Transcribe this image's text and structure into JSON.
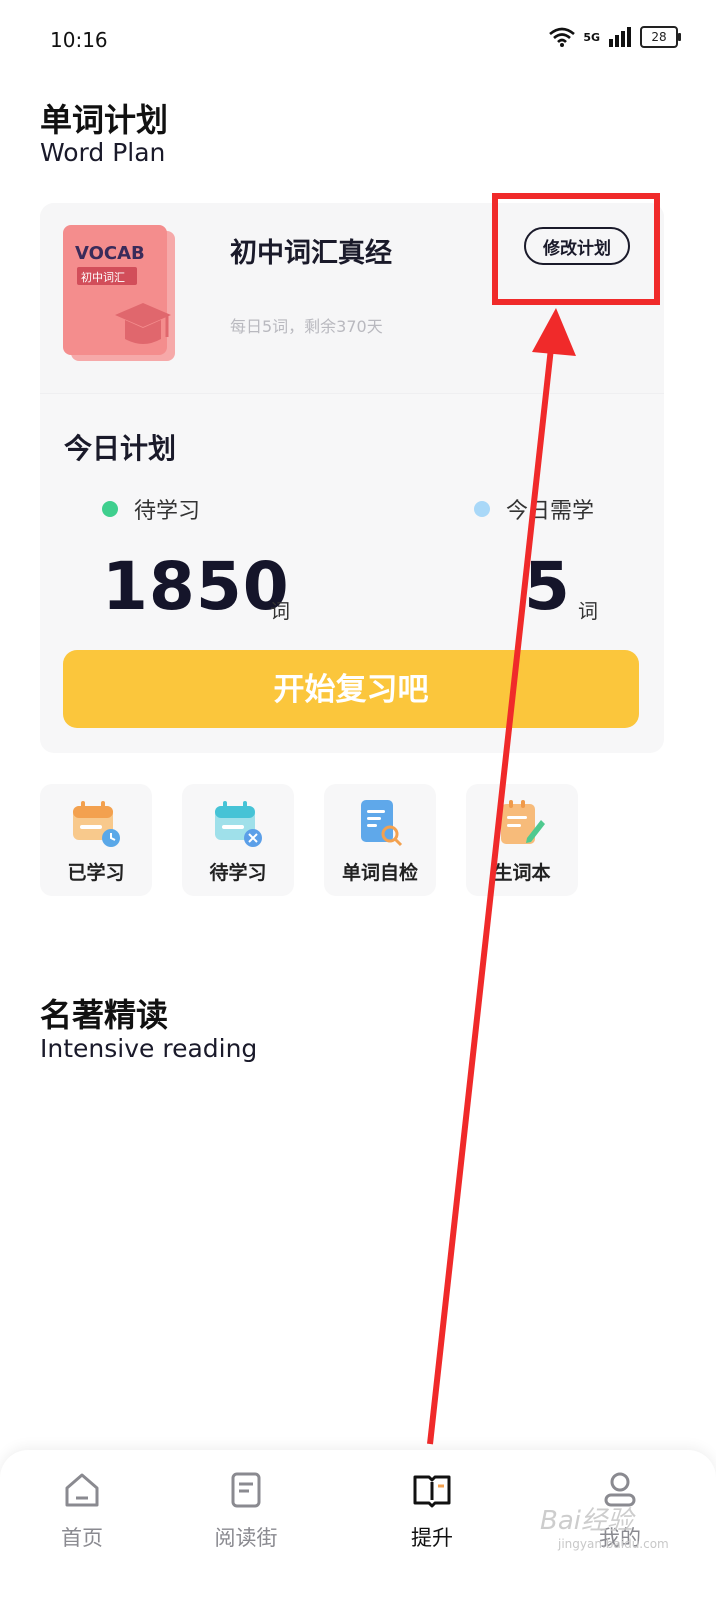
{
  "status_bar": {
    "time": "10:16",
    "network": "5G",
    "battery": "28"
  },
  "word_plan": {
    "title": "单词计划",
    "subtitle": "Word Plan"
  },
  "book": {
    "cover_title": "VOCAB",
    "cover_tag": "初中词汇",
    "title": "初中词汇真经",
    "progress": "每日5词，剩余370天",
    "modify_label": "修改计划"
  },
  "today": {
    "title": "今日计划",
    "pending_label": "待学习",
    "pending_count": "1850",
    "need_label": "今日需学",
    "need_count": "5",
    "unit": "词",
    "pending_color": "#3fcf8e",
    "need_color": "#a9d8f8",
    "start_label": "开始复习吧"
  },
  "tools": [
    {
      "label": "已学习",
      "icon": "calendar-clock-icon"
    },
    {
      "label": "待学习",
      "icon": "calendar-x-icon"
    },
    {
      "label": "单词自检",
      "icon": "document-search-icon"
    },
    {
      "label": "生词本",
      "icon": "notebook-pen-icon"
    }
  ],
  "reading": {
    "title": "名著精读",
    "subtitle": "Intensive reading"
  },
  "tabs": [
    {
      "label": "首页",
      "icon": "home-icon"
    },
    {
      "label": "阅读街",
      "icon": "reading-icon"
    },
    {
      "label": "提升",
      "icon": "book-open-icon",
      "active": true
    },
    {
      "label": "我的",
      "icon": "profile-icon"
    }
  ],
  "watermark": {
    "text": "Bai经验",
    "sub": "jingyan.baidu.com"
  },
  "colors": {
    "accent": "#fbc63c",
    "annotation": "#f02a2a"
  }
}
